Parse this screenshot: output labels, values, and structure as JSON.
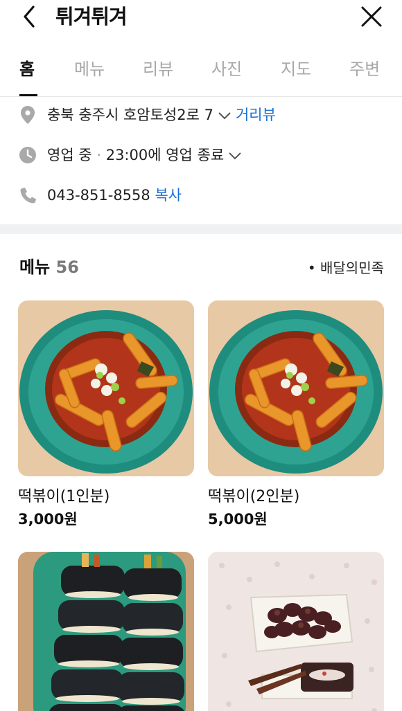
{
  "header": {
    "title": "튀겨튀겨"
  },
  "tabs": [
    {
      "label": "홈"
    },
    {
      "label": "메뉴"
    },
    {
      "label": "리뷰"
    },
    {
      "label": "사진"
    },
    {
      "label": "지도"
    },
    {
      "label": "주변"
    }
  ],
  "info": {
    "address": "충북 충주시 호암토성2로 7",
    "address_link": "거리뷰",
    "status": "영업 중",
    "status_detail": "23:00에 영업 종료",
    "phone": "043-851-8558",
    "phone_link": "복사"
  },
  "menu": {
    "title": "메뉴",
    "count": "56",
    "source": "배달의민족",
    "items": [
      {
        "name": "떡볶이(1인분)",
        "price": "3,000원",
        "image": "tteokbokki-photo"
      },
      {
        "name": "떡볶이(2인분)",
        "price": "5,000원",
        "image": "tteokbokki-photo"
      },
      {
        "name": "",
        "price": "",
        "image": "gimbap-photo"
      },
      {
        "name": "",
        "price": "",
        "image": "sundae-photo"
      }
    ]
  },
  "colors": {
    "accent_link": "#1a6fd4",
    "divider": "#f0f1f3",
    "inactive_tab": "#a8a8a8"
  }
}
